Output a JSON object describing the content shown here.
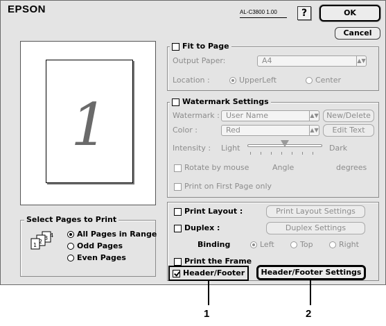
{
  "header": {
    "brand": "EPSON",
    "model": "AL-C3800 1.00",
    "help_label": "?",
    "ok_label": "OK",
    "cancel_label": "Cancel"
  },
  "preview": {
    "page_number": "1"
  },
  "select_pages": {
    "title": "Select Pages to Print",
    "icon": "pages-stack-icon",
    "options": [
      "All Pages in Range",
      "Odd Pages",
      "Even Pages"
    ],
    "selected": "All Pages in Range"
  },
  "fit_to_page": {
    "label": "Fit to Page",
    "checked": false,
    "output_paper_label": "Output Paper:",
    "output_paper_value": "A4",
    "location_label": "Location :",
    "location_options": [
      "UpperLeft",
      "Center"
    ],
    "location_selected": "UpperLeft"
  },
  "watermark": {
    "label": "Watermark Settings",
    "checked": false,
    "watermark_label": "Watermark :",
    "watermark_value": "User Name",
    "new_delete_label": "New/Delete",
    "color_label": "Color :",
    "color_value": "Red",
    "edit_text_label": "Edit Text",
    "intensity_label": "Intensity :",
    "light_label": "Light",
    "dark_label": "Dark",
    "rotate_label": "Rotate by mouse",
    "angle_label": "Angle",
    "degrees_label": "degrees",
    "first_page_label": "Print on First Page only"
  },
  "layout": {
    "print_layout_label": "Print Layout :",
    "print_layout_settings_label": "Print Layout Settings",
    "duplex_label": "Duplex :",
    "duplex_settings_label": "Duplex Settings",
    "binding_label": "Binding",
    "binding_options": [
      "Left",
      "Top",
      "Right"
    ],
    "binding_selected": "Left",
    "print_frame_label": "Print the Frame",
    "header_footer_label": "Header/Footer",
    "header_footer_checked": true,
    "header_footer_settings_label": "Header/Footer Settings"
  },
  "callouts": {
    "one": "1",
    "two": "2"
  }
}
